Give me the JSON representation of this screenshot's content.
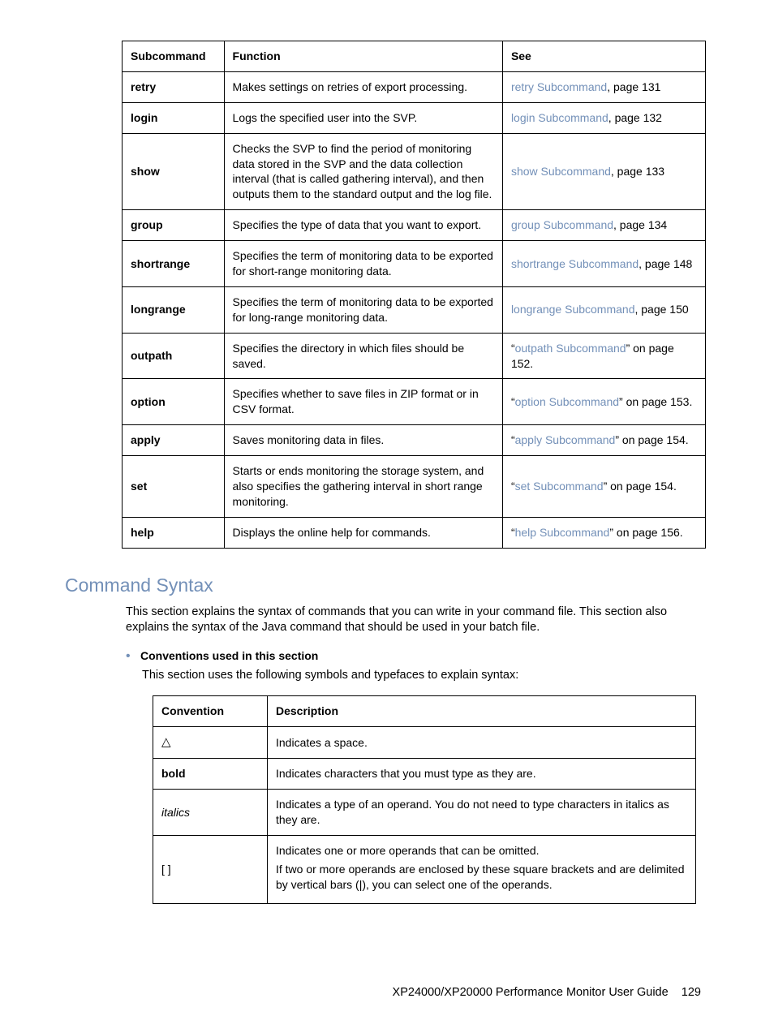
{
  "table1": {
    "headers": {
      "c1": "Subcommand",
      "c2": "Function",
      "c3": "See"
    },
    "rows": [
      {
        "name": "retry",
        "func": "Makes settings on retries of export processing.",
        "link": "retry Subcommand",
        "suffix": ", page 131"
      },
      {
        "name": "login",
        "func": "Logs the specified user into the SVP.",
        "link": "login Subcommand",
        "suffix": ", page 132"
      },
      {
        "name": "show",
        "func": "Checks the SVP to find the period of monitoring data stored in the SVP and the data collection interval (that is called gathering interval), and then outputs them to the standard output and the log file.",
        "link": "show Subcommand",
        "suffix": ", page 133"
      },
      {
        "name": "group",
        "func": "Specifies the type of data that you want to export.",
        "link": "group Subcommand",
        "suffix": ", page 134"
      },
      {
        "name": "shortrange",
        "func": "Specifies the term of monitoring data to be exported for short-range monitoring data.",
        "link": "shortrange Subcommand",
        "suffix": ", page 148"
      },
      {
        "name": "longrange",
        "func": "Specifies the term of monitoring data to be exported for long-range monitoring data.",
        "link": "longrange Subcommand",
        "suffix": ", page 150"
      },
      {
        "name": "outpath",
        "func": "Specifies the directory in which files should be saved.",
        "pre": "“",
        "link": "outpath Subcommand",
        "suffix": "” on page 152."
      },
      {
        "name": "option",
        "func": "Specifies whether to save files in ZIP format or in CSV format.",
        "pre": "“",
        "link": "option Subcommand",
        "suffix": "” on page 153."
      },
      {
        "name": "apply",
        "func": "Saves monitoring data in files.",
        "pre": "“",
        "link": "apply Subcommand",
        "suffix": "” on page 154."
      },
      {
        "name": "set",
        "func": "Starts or ends monitoring the storage system, and also specifies the gathering interval in short range monitoring.",
        "pre": "“",
        "link": "set Subcommand",
        "suffix": "” on page 154."
      },
      {
        "name": "help",
        "func": "Displays the online help for commands.",
        "pre": "“",
        "link": "help Subcommand",
        "suffix": "” on page 156."
      }
    ]
  },
  "section_title": "Command Syntax",
  "intro": "This section explains the syntax of commands that you can write in your command file. This section also explains the syntax of the Java command that should be used in your batch file.",
  "bullet": "Conventions used in this section",
  "subintro": "This section uses the following symbols and typefaces to explain syntax:",
  "table2": {
    "headers": {
      "c1": "Convention",
      "c2": "Description"
    },
    "rows": [
      {
        "conv_type": "triangle",
        "conv_text": "△",
        "desc": "Indicates a space."
      },
      {
        "conv_type": "bold",
        "conv_text": "bold",
        "desc": "Indicates characters that you must type as they are."
      },
      {
        "conv_type": "italic",
        "conv_text": "italics",
        "desc": "Indicates a type of an operand. You do not need to type characters in italics as they are."
      },
      {
        "conv_type": "plain",
        "conv_text": "[ ]",
        "desc1": "Indicates one or more operands that can be omitted.",
        "desc2": "If two or more operands are enclosed by these square brackets and are delimited by vertical bars (|), you can select one of the operands."
      }
    ]
  },
  "footer": {
    "title": "XP24000/XP20000 Performance Monitor User Guide",
    "page": "129"
  }
}
